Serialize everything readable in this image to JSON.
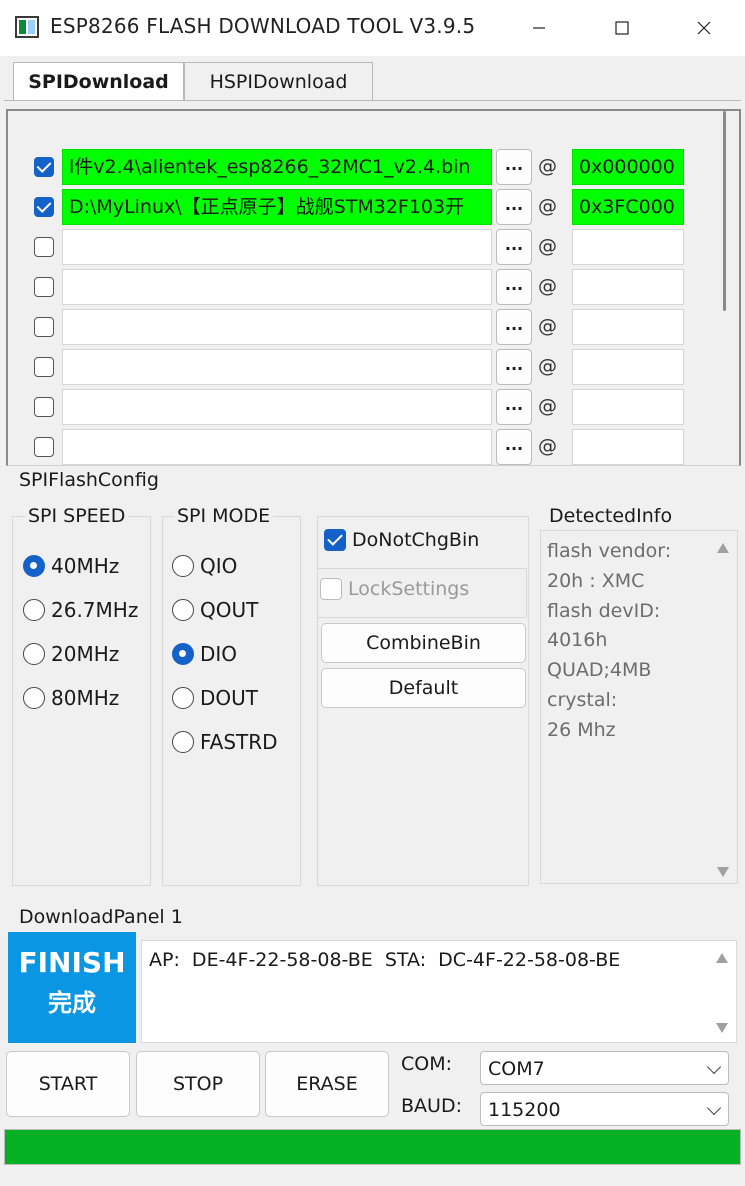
{
  "window": {
    "title": "ESP8266 FLASH DOWNLOAD TOOL V3.9.5"
  },
  "tabs": [
    {
      "label": "SPIDownload",
      "active": true
    },
    {
      "label": "HSPIDownload",
      "active": false
    }
  ],
  "files": [
    {
      "checked": true,
      "path": "l件v2.4\\alientek_esp8266_32MC1_v2.4.bin",
      "browse": "...",
      "at": "@",
      "address": "0x000000"
    },
    {
      "checked": true,
      "path": "D:\\MyLinux\\【正点原子】战舰STM32F103开",
      "browse": "...",
      "at": "@",
      "address": "0x3FC000"
    },
    {
      "checked": false,
      "path": "",
      "browse": "...",
      "at": "@",
      "address": ""
    },
    {
      "checked": false,
      "path": "",
      "browse": "...",
      "at": "@",
      "address": ""
    },
    {
      "checked": false,
      "path": "",
      "browse": "...",
      "at": "@",
      "address": ""
    },
    {
      "checked": false,
      "path": "",
      "browse": "...",
      "at": "@",
      "address": ""
    },
    {
      "checked": false,
      "path": "",
      "browse": "...",
      "at": "@",
      "address": ""
    },
    {
      "checked": false,
      "path": "",
      "browse": "...",
      "at": "@",
      "address": ""
    }
  ],
  "spi_flash_config": {
    "label": "SPIFlashConfig",
    "spi_speed": {
      "label": "SPI SPEED",
      "options": [
        "40MHz",
        "26.7MHz",
        "20MHz",
        "80MHz"
      ],
      "selected": "40MHz"
    },
    "spi_mode": {
      "label": "SPI MODE",
      "options": [
        "QIO",
        "QOUT",
        "DIO",
        "DOUT",
        "FASTRD"
      ],
      "selected": "DIO"
    },
    "do_not_chg_bin": {
      "label": "DoNotChgBin",
      "checked": true
    },
    "lock_settings": {
      "label": "LockSettings",
      "checked": false
    },
    "combine_bin_label": "CombineBin",
    "default_label": "Default"
  },
  "detected_info": {
    "label": "DetectedInfo",
    "lines": [
      "flash vendor:",
      "20h : XMC",
      "flash devID:",
      "4016h",
      "QUAD;4MB",
      "crystal:",
      "26 Mhz"
    ]
  },
  "download_panel": {
    "label": "DownloadPanel 1",
    "status_en": "FINISH",
    "status_zh": "完成",
    "status_color": "#0b96e4",
    "log": "AP:  DE-4F-22-58-08-BE  STA:  DC-4F-22-58-08-BE"
  },
  "controls": {
    "start_label": "START",
    "stop_label": "STOP",
    "erase_label": "ERASE",
    "com_label": "COM:",
    "com_value": "COM7",
    "baud_label": "BAUD:",
    "baud_value": "115200"
  },
  "progress": {
    "fraction": 1.0,
    "color": "#06b025"
  }
}
